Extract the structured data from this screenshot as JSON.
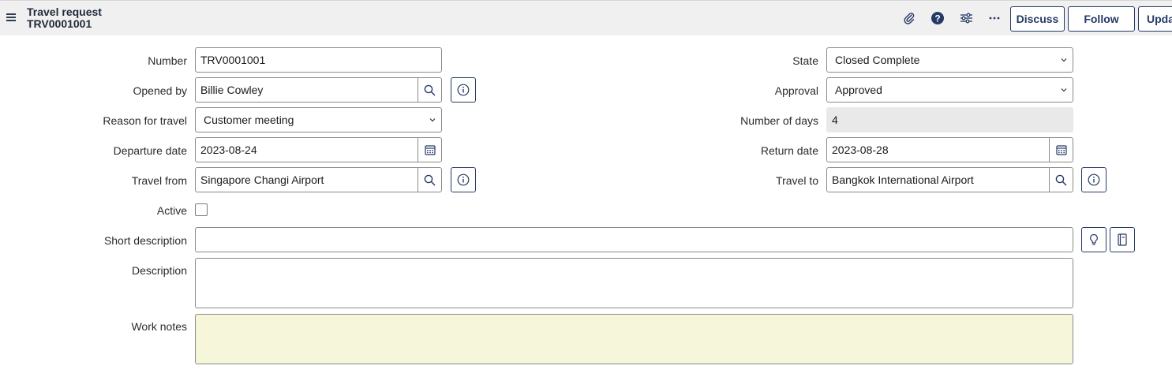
{
  "header": {
    "title": "Travel request",
    "number": "TRV0001001",
    "buttons": {
      "discuss": "Discuss",
      "follow": "Follow",
      "update": "Upda"
    },
    "icons": [
      "paperclip-icon",
      "help-icon",
      "sliders-icon",
      "more-icon"
    ]
  },
  "form": {
    "number": {
      "label": "Number",
      "value": "TRV0001001"
    },
    "opened_by": {
      "label": "Opened by",
      "value": "Billie Cowley"
    },
    "reason": {
      "label": "Reason for travel",
      "value": "Customer meeting"
    },
    "departure": {
      "label": "Departure date",
      "value": "2023-08-24"
    },
    "travel_from": {
      "label": "Travel from",
      "value": "Singapore Changi Airport"
    },
    "active": {
      "label": "Active",
      "checked": false
    },
    "state": {
      "label": "State",
      "value": "Closed Complete"
    },
    "approval": {
      "label": "Approval",
      "value": "Approved"
    },
    "num_days": {
      "label": "Number of days",
      "value": "4"
    },
    "return_date": {
      "label": "Return date",
      "value": "2023-08-28"
    },
    "travel_to": {
      "label": "Travel to",
      "value": "Bangkok International Airport"
    },
    "short_desc": {
      "label": "Short description",
      "value": ""
    },
    "description": {
      "label": "Description",
      "value": ""
    },
    "work_notes": {
      "label": "Work notes",
      "value": ""
    }
  },
  "colors": {
    "accent": "#253a66",
    "header_bg": "#f0f0f1",
    "work_notes_bg": "#f6f6da",
    "readonly_bg": "#e9e9ea"
  }
}
